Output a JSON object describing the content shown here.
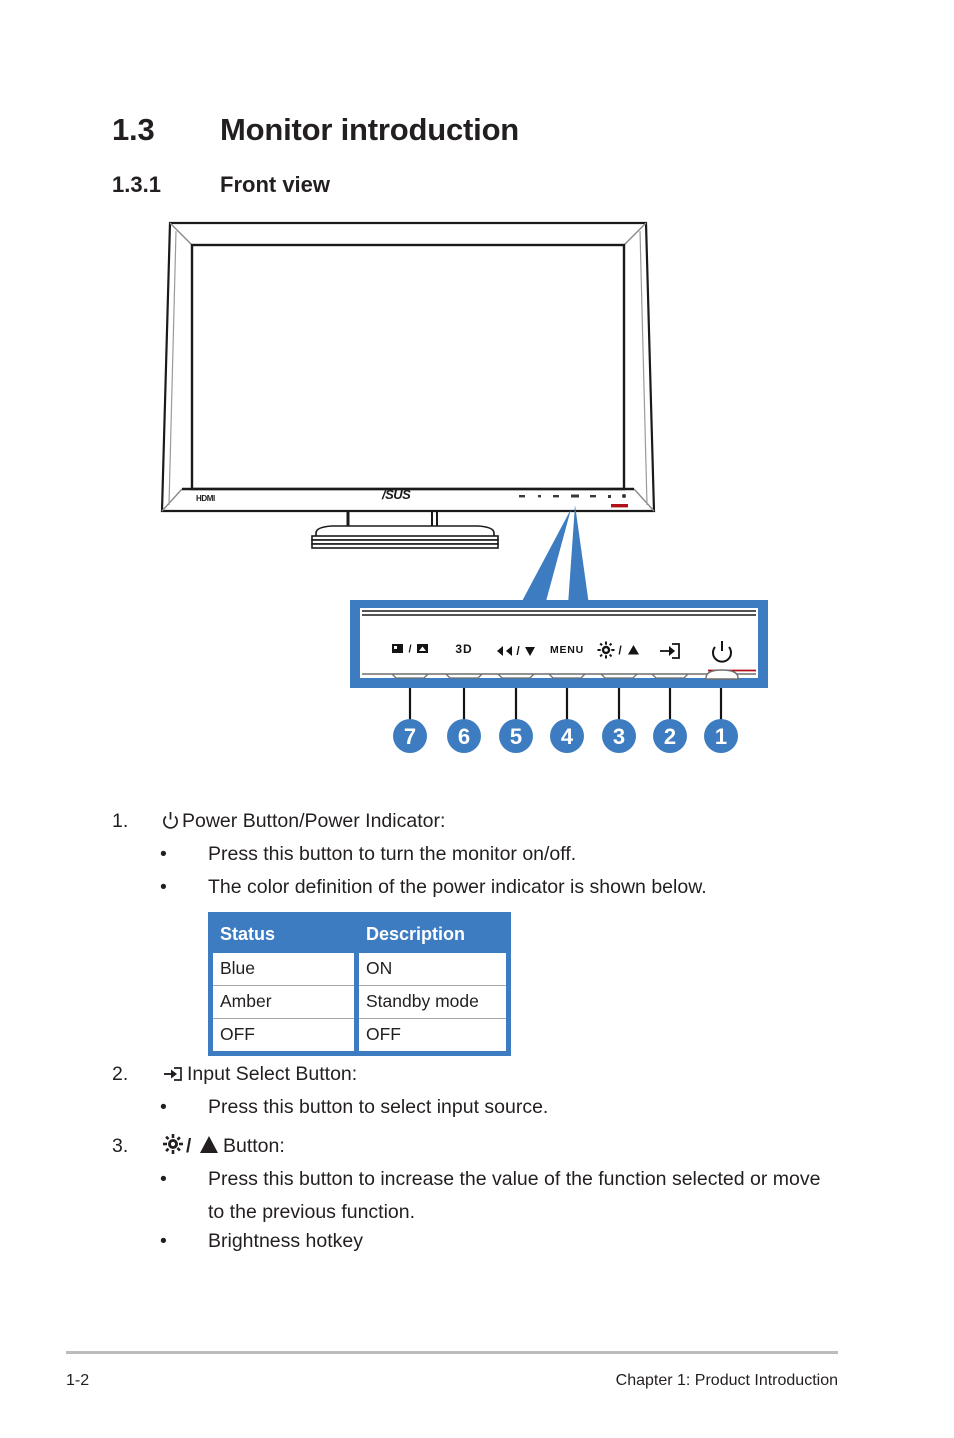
{
  "document": {
    "heading": {
      "number": "1.3",
      "title": "Monitor introduction"
    },
    "subheading": {
      "number": "1.3.1",
      "title": "Front view"
    }
  },
  "figure": {
    "name": "front-view-diagram",
    "accent_color": "#3d7cc0",
    "monitor": {
      "brand_logo": "/SUS",
      "port_label": "HDMI",
      "power_led_color": "#b01116"
    },
    "control_panel": {
      "buttons": [
        {
          "callout": "7",
          "label": "▣/▣",
          "icon": "splendid-mode-icon"
        },
        {
          "callout": "6",
          "label": "3D",
          "icon": "three-d-icon"
        },
        {
          "callout": "5",
          "label": "◁▷/▼",
          "icon": "volume-down-icon"
        },
        {
          "callout": "4",
          "label": "MENU",
          "icon": "menu-icon"
        },
        {
          "callout": "3",
          "label": "☀/▲",
          "icon": "brightness-up-icon"
        },
        {
          "callout": "2",
          "label": "→]",
          "icon": "input-select-icon"
        },
        {
          "callout": "1",
          "label": "⏻",
          "icon": "power-icon"
        }
      ],
      "callout_order": [
        "7",
        "6",
        "5",
        "4",
        "3",
        "2",
        "1"
      ]
    }
  },
  "content": {
    "items": [
      {
        "number": "1.",
        "icon": "power-icon",
        "title": "Power Button/Power Indicator:",
        "bullets": [
          "Press this button to turn the monitor on/off.",
          "The color definition of the power indicator is shown below."
        ]
      },
      {
        "number": "2.",
        "icon": "input-select-icon",
        "title": "Input Select Button:",
        "bullets": [
          "Press this button to select input source."
        ]
      },
      {
        "number": "3.",
        "icon": "brightness-up-icon",
        "title": "Button:",
        "bullets": [
          "Press this button to increase the value of the function selected or move to the previous function.",
          "Brightness hotkey"
        ]
      }
    ],
    "status_table": {
      "header_color": "#3d7cc0",
      "columns": [
        "Status",
        "Description"
      ],
      "rows": [
        [
          "Blue",
          "ON"
        ],
        [
          "Amber",
          "Standby mode"
        ],
        [
          "OFF",
          "OFF"
        ]
      ]
    }
  },
  "footer": {
    "page_number": "1-2",
    "chapter": "Chapter 1: Product Introduction"
  }
}
